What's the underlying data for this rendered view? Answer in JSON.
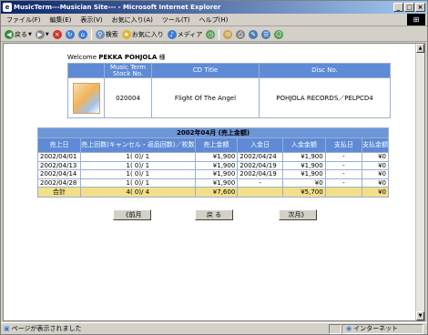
{
  "window": {
    "title": "MusicTerm---Musician Site--- - Microsoft Internet Explorer",
    "minimize": "_",
    "maximize": "□",
    "close": "×"
  },
  "menu": {
    "items": [
      "ファイル(F)",
      "編集(E)",
      "表示(V)",
      "お気に入り(A)",
      "ツール(T)",
      "ヘルプ(H)"
    ]
  },
  "toolbar": {
    "back": "戻る",
    "search": "検索",
    "favorites": "お気に入り",
    "media": "メディア"
  },
  "page": {
    "welcome_prefix": "Welcome",
    "user_name": "PEKKA POHJOLA",
    "honorific": "様",
    "album_headers": [
      "Music Term Stock No.",
      "CD Title",
      "Disc No."
    ],
    "album": {
      "stock_no": "020004",
      "title": "Flight Of The Angel",
      "disc_no": "POHJOLA RECORDS／PELPCD4"
    },
    "sales_caption": "2002年04月 (売上金額)",
    "sales_headers": [
      "売上日",
      "売上回数(キャンセル・返品回数)／枚数",
      "売上金額",
      "入金日",
      "入金金額",
      "支払日",
      "支払金額"
    ],
    "rows": [
      [
        "2002/04/01",
        "1( 0)/ 1",
        "¥1,900",
        "2002/04/24",
        "¥1,900",
        "-",
        "¥0"
      ],
      [
        "2002/04/13",
        "1( 0)/ 1",
        "¥1,900",
        "2002/04/19",
        "¥1,900",
        "-",
        "¥0"
      ],
      [
        "2002/04/14",
        "1( 0)/ 1",
        "¥1,900",
        "2002/04/19",
        "¥1,900",
        "-",
        "¥0"
      ],
      [
        "2002/04/28",
        "1( 0)/ 1",
        "¥1,900",
        "-",
        "¥0",
        "-",
        "¥0"
      ]
    ],
    "total": [
      "合計",
      "4( 0)/ 4",
      "¥7,600",
      "",
      "¥5,700",
      "",
      "¥0"
    ],
    "nav": {
      "prev": "《前月",
      "back": "戻 る",
      "next": "次月》"
    }
  },
  "status": {
    "message": "ページが表示されました",
    "zone": "インターネット"
  }
}
